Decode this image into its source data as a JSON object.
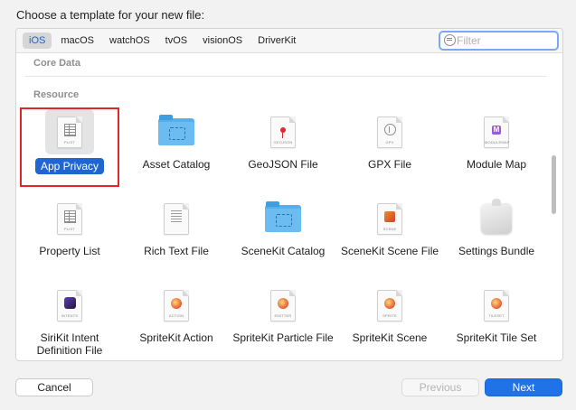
{
  "dialog": {
    "heading": "Choose a template for your new file:"
  },
  "tabs": [
    {
      "label": "iOS",
      "active": true
    },
    {
      "label": "macOS",
      "active": false
    },
    {
      "label": "watchOS",
      "active": false
    },
    {
      "label": "tvOS",
      "active": false
    },
    {
      "label": "visionOS",
      "active": false
    },
    {
      "label": "DriverKit",
      "active": false
    }
  ],
  "filter": {
    "placeholder": "Filter",
    "value": ""
  },
  "sections": {
    "core_data": "Core Data",
    "resource": "Resource"
  },
  "templates": [
    {
      "label": "App Privacy",
      "icon": "plist-icon",
      "icon_caption": "PLIST",
      "selected": true
    },
    {
      "label": "Asset Catalog",
      "icon": "asset-catalog-folder-icon",
      "icon_caption": "",
      "selected": false
    },
    {
      "label": "GeoJSON File",
      "icon": "geojson-icon",
      "icon_caption": "GEOJSON",
      "selected": false
    },
    {
      "label": "GPX File",
      "icon": "gpx-icon",
      "icon_caption": "GPX",
      "selected": false
    },
    {
      "label": "Module Map",
      "icon": "module-map-icon",
      "icon_caption": "MODULEMAP",
      "selected": false
    },
    {
      "label": "Property List",
      "icon": "plist-icon",
      "icon_caption": "PLIST",
      "selected": false
    },
    {
      "label": "Rich Text File",
      "icon": "rich-text-icon",
      "icon_caption": "",
      "selected": false
    },
    {
      "label": "SceneKit Catalog",
      "icon": "scenekit-catalog-folder-icon",
      "icon_caption": "",
      "selected": false
    },
    {
      "label": "SceneKit Scene File",
      "icon": "scenekit-scene-icon",
      "icon_caption": "SCENE",
      "selected": false
    },
    {
      "label": "Settings Bundle",
      "icon": "settings-bundle-icon",
      "icon_caption": "",
      "selected": false
    },
    {
      "label": "SiriKit Intent Definition File",
      "icon": "intents-icon",
      "icon_caption": "INTENTS",
      "selected": false
    },
    {
      "label": "SpriteKit Action",
      "icon": "spritekit-action-icon",
      "icon_caption": "ACTION",
      "selected": false
    },
    {
      "label": "SpriteKit Particle File",
      "icon": "spritekit-emitter-icon",
      "icon_caption": "EMITTER",
      "selected": false
    },
    {
      "label": "SpriteKit Scene",
      "icon": "spritekit-scene-icon",
      "icon_caption": "SPRITE",
      "selected": false
    },
    {
      "label": "SpriteKit Tile Set",
      "icon": "spritekit-tileset-icon",
      "icon_caption": "TILESET",
      "selected": false
    }
  ],
  "buttons": {
    "cancel": "Cancel",
    "previous": "Previous",
    "next": "Next"
  },
  "colors": {
    "accent": "#1f72e8",
    "selection_highlight": "#e0262b"
  }
}
